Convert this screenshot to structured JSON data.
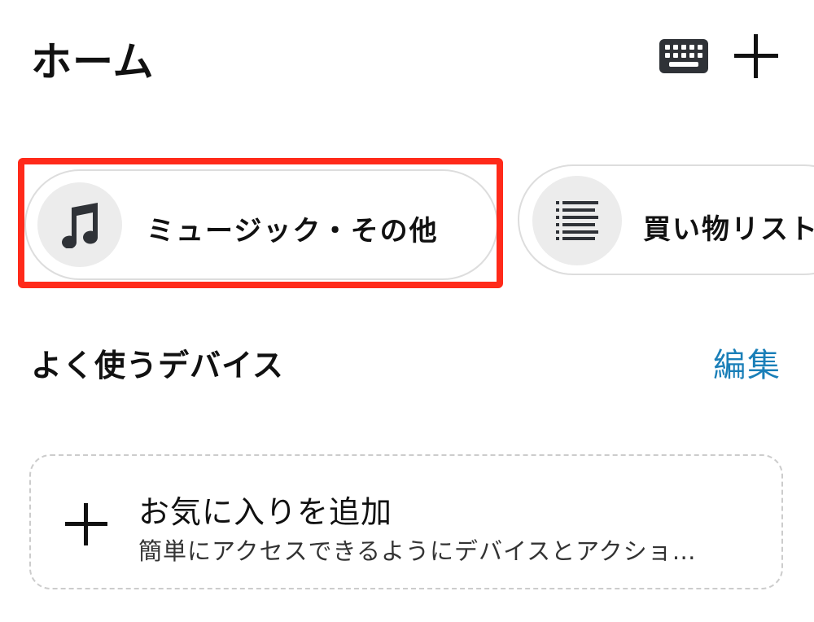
{
  "header": {
    "title": "ホーム",
    "keyboard_icon": "keyboard-icon",
    "add_icon": "plus-icon"
  },
  "chips": [
    {
      "label": "ミュージック・その他",
      "icon": "music-note-icon",
      "highlighted": true
    },
    {
      "label": "買い物リスト",
      "icon": "list-icon",
      "highlighted": false
    }
  ],
  "favorites_section": {
    "title": "よく使うデバイス",
    "edit_label": "編集",
    "add_card": {
      "icon": "plus-icon",
      "title": "お気に入りを追加",
      "subtitle": "簡単にアクセスできるようにデバイスとアクショ…"
    }
  },
  "colors": {
    "highlight": "#ff2a1a",
    "link": "#1a7fb8",
    "icon_dark": "#2f3237",
    "chip_circle": "#ececec"
  }
}
